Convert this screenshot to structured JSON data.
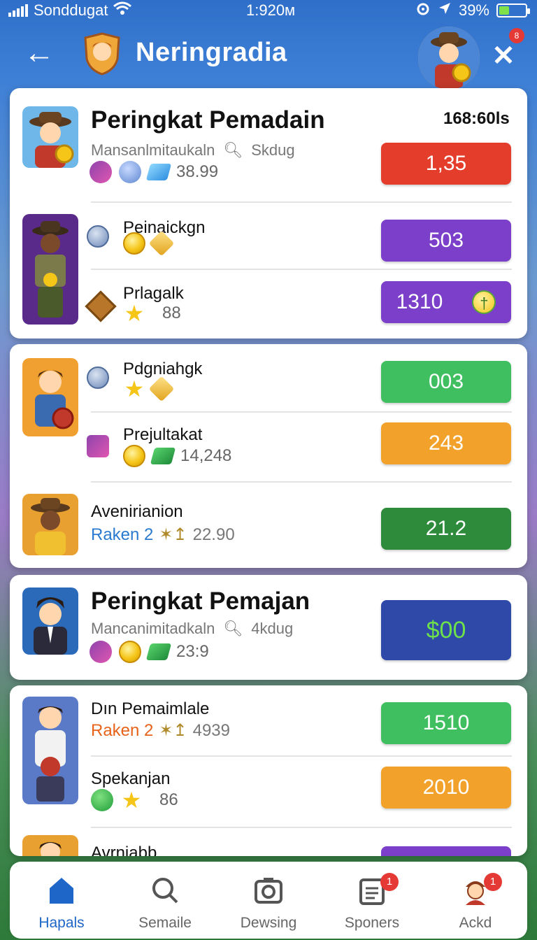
{
  "status_bar": {
    "carrier": "Sonddugat",
    "time": "1:920м",
    "battery": "39%",
    "battery_level": 0.39
  },
  "header": {
    "title": "Neringradia",
    "close_badge": "8"
  },
  "cards": [
    {
      "title": "Peringkat Pemadain",
      "subtitle": "Mansanlmitaukaln",
      "search_label": "Skdug",
      "timer": "168:60ls",
      "stat": "38.99",
      "score": "1,35",
      "score_color": "#e53d2b",
      "rows": [
        {
          "name": "Peinaickgn",
          "score": "503",
          "score_color": "#7b3fc9"
        },
        {
          "name": "Prlagalk",
          "stat": "88",
          "score": "1310",
          "score_color": "#7b3fc9"
        }
      ]
    },
    {
      "rows": [
        {
          "name": "Pdgniahgk",
          "score": "003",
          "score_color": "#3fbf5f"
        },
        {
          "name": "Prejultakat",
          "stat": "14,248",
          "score": "243",
          "score_color": "#f2a22a"
        },
        {
          "name": "Avenirianion",
          "rank": "Raken 2",
          "stat": "22.90",
          "score": "21.2",
          "score_color": "#2e8b3c"
        }
      ]
    },
    {
      "title": "Peringkat Pemajan",
      "subtitle": "Mancanimitadkaln",
      "search_label": "4kdug",
      "stat": "23:9",
      "score": "$00",
      "score_color": "#2e49a8",
      "score_text_color": "#6ee04a"
    },
    {
      "rows": [
        {
          "name": "Dın Pemaimlale",
          "rank": "Raken 2",
          "stat": "4939",
          "score": "1510",
          "score_color": "#3fbf5f"
        },
        {
          "name": "Spekanjan",
          "stat": "86",
          "score": "2010",
          "score_color": "#f2a22a"
        },
        {
          "name": "Avrnjabb",
          "score_color": "#7b3fc9"
        }
      ]
    }
  ],
  "nav": [
    {
      "label": "Hapals",
      "icon": "home-icon",
      "active": true
    },
    {
      "label": "Semaile",
      "icon": "search-icon"
    },
    {
      "label": "Dewsing",
      "icon": "camera-icon"
    },
    {
      "label": "Sponers",
      "icon": "clipboard-icon",
      "badge": "1"
    },
    {
      "label": "Ackd",
      "icon": "profile-icon",
      "badge": "1"
    }
  ]
}
